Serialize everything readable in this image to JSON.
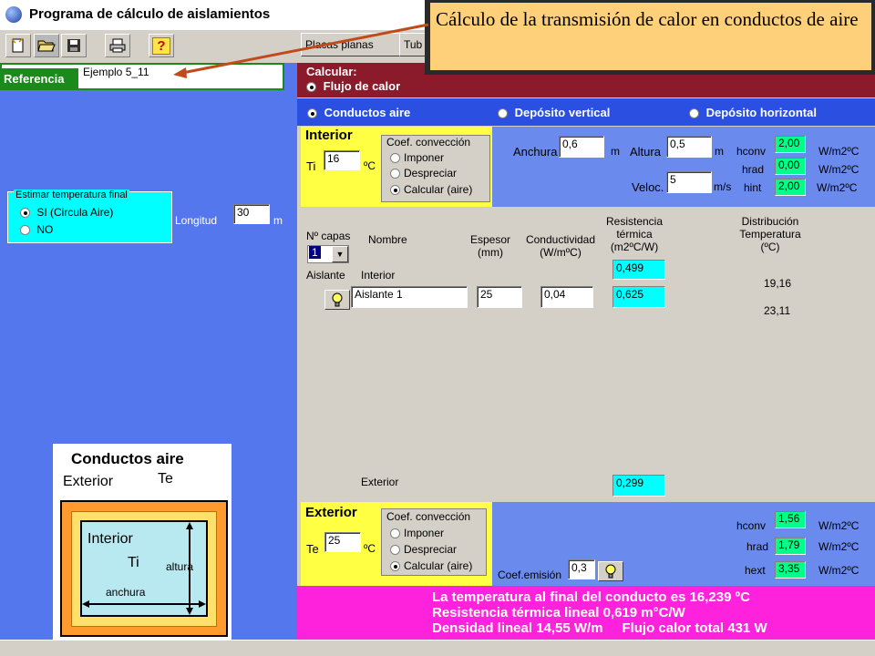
{
  "window": {
    "title": "Programa de cálculo de aislamientos"
  },
  "toolbar": {
    "icons": [
      "new-file-icon",
      "open-folder-icon",
      "save-disk-icon",
      "print-icon",
      "help-icon"
    ],
    "help_label": "?",
    "tab_placas": "Placas planas",
    "tab_tub": "Tub"
  },
  "callout": {
    "text": "Cálculo de la transmisión de calor en conductos de aire"
  },
  "referencia": {
    "label": "Referencia",
    "value": "Ejemplo 5_11"
  },
  "estimar": {
    "title": "Estimar temperatura final",
    "opt_si": "SI  (Circula Aire)",
    "opt_no": "NO",
    "longitud_label": "Longitud",
    "longitud_value": "30",
    "longitud_unit": "m"
  },
  "diagram": {
    "title": "Conductos aire",
    "exterior": "Exterior",
    "te": "Te",
    "interior": "Interior",
    "ti": "Ti",
    "altura": "altura",
    "anchura": "anchura"
  },
  "calcular": {
    "label": "Calcular:",
    "option": "Flujo de calor"
  },
  "geometry": {
    "opt_conductos": "Conductos aire",
    "opt_vertical": "Depósito vertical",
    "opt_horizontal": "Depósito horizontal"
  },
  "interior": {
    "title": "Interior",
    "ti_label": "Ti",
    "ti_value": "16",
    "ti_unit": "ºC",
    "coef_title": "Coef. convección",
    "coef_imponer": "Imponer",
    "coef_despreciar": "Despreciar",
    "coef_calcular": "Calcular (aire)",
    "anchura_label": "Anchura",
    "anchura_value": "0,6",
    "anchura_unit": "m",
    "altura_label": "Altura",
    "altura_value": "0,5",
    "altura_unit": "m",
    "veloc_label": "Veloc.",
    "veloc_value": "5",
    "veloc_unit": "m/s",
    "hconv_label": "hconv",
    "hconv_value": "2,00",
    "hrad_label": "hrad",
    "hrad_value": "0,00",
    "hint_label": "hint",
    "hint_value": "2,00",
    "unit": "W/m2ºC"
  },
  "layers": {
    "ncapas_label": "Nº capas",
    "ncapas_value": "1",
    "nombre_header": "Nombre",
    "espesor_header": "Espesor (mm)",
    "espesor_h1": "Espesor",
    "espesor_h2": "(mm)",
    "cond_h1": "Conductividad",
    "cond_h2": "(W/mºC)",
    "res_h1": "Resistencia",
    "res_h2": "térmica",
    "res_h3": "(m2ºC/W)",
    "dist_h1": "Distribución",
    "dist_h2": "Temperatura",
    "dist_h3": "(ºC)",
    "aislante_label": "Aislante",
    "interior_label": "Interior",
    "r_interior": "0,499",
    "t1": "19,16",
    "layer1_name": "Aislante 1",
    "layer1_espesor": "25",
    "layer1_cond": "0,04",
    "layer1_res": "0,625",
    "t2": "23,11",
    "exterior_label": "Exterior",
    "r_exterior": "0,299"
  },
  "exterior": {
    "title": "Exterior",
    "te_label": "Te",
    "te_value": "25",
    "te_unit": "ºC",
    "coef_title": "Coef. convección",
    "coef_imponer": "Imponer",
    "coef_despreciar": "Despreciar",
    "coef_calcular": "Calcular (aire)",
    "emision_label": "Coef.emisión",
    "emision_value": "0,3",
    "hconv_label": "hconv",
    "hconv_value": "1,56",
    "hrad_label": "hrad",
    "hrad_value": "1,79",
    "hext_label": "hext",
    "hext_value": "3,35",
    "unit": "W/m2ºC"
  },
  "results": {
    "line1": "La temperatura al final del conducto es 16,239 ºC",
    "line2": "Resistencia térmica lineal 0,619 m°C/W",
    "line3": "Densidad lineal 14,55 W/m     Flujo calor total 431 W"
  }
}
